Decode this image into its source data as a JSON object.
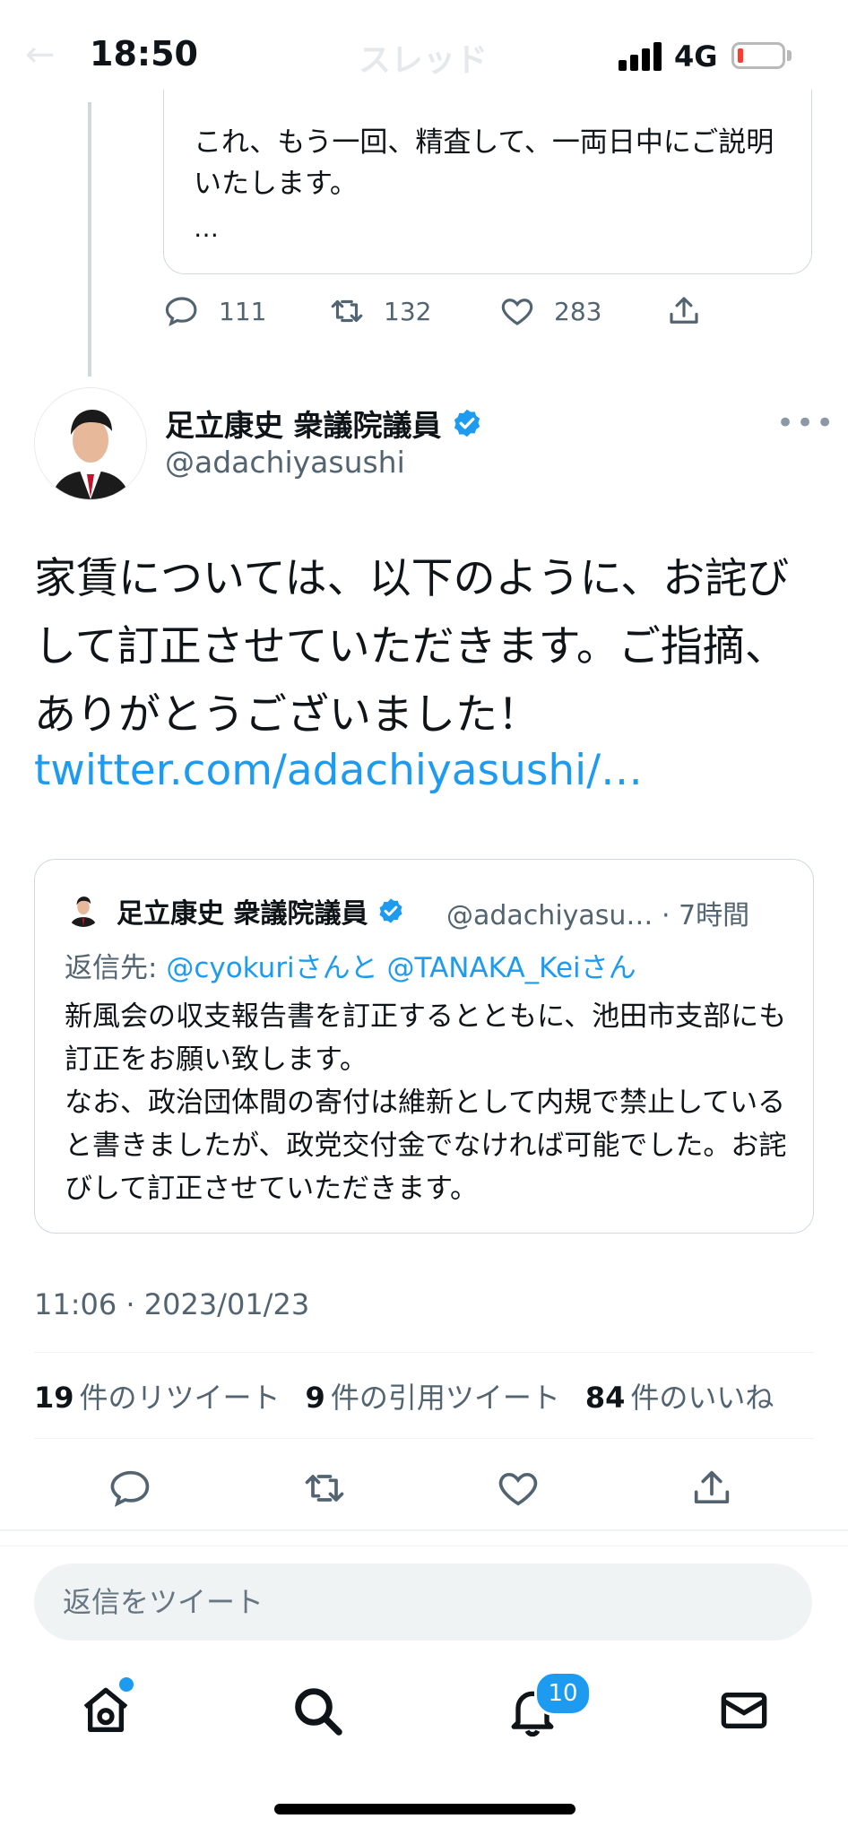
{
  "status_bar": {
    "time": "18:50",
    "network": "4G",
    "ghost_title": "スレッド"
  },
  "previous_tweet": {
    "text": "これ、もう一回、精査して、一両日中にご説明いたします。",
    "ellipsis": "…",
    "replies": "111",
    "retweets": "132",
    "likes": "283"
  },
  "tweet": {
    "display_name": "足立康史 衆議院議員",
    "handle": "@adachiyasushi",
    "body": "家賃については、以下のように、お詫びして訂正させていただきます。ご指摘、ありがとうございました！",
    "link": "twitter.com/adachiyasushi/…",
    "timestamp": "11:06 · 2023/01/23",
    "retweets_count": "19",
    "retweets_label": "件のリツイート",
    "quotes_count": "9",
    "quotes_label": "件の引用ツイート",
    "likes_count": "84",
    "likes_label": "件のいいね"
  },
  "quoted_tweet": {
    "display_name": "足立康史 衆議院議員",
    "handle": "@adachiyasu…",
    "time": "· 7時間",
    "reply_prefix": "返信先: ",
    "reply_user1": "@cyokuri",
    "reply_mid": "さんと ",
    "reply_user2": "@TANAKA_Kei",
    "reply_suffix": "さん",
    "text": "新風会の収支報告書を訂正するとともに、池田市支部にも訂正をお願い致します。\nなお、政治団体間の寄付は維新として内規で禁止していると書きましたが、政党交付金でなければ可能でした。お詫びして訂正させていただきます。"
  },
  "reply_bar": {
    "placeholder": "返信をツイート"
  },
  "tab_bar": {
    "notifications_badge": "10"
  },
  "colors": {
    "accent": "#1d9bf0",
    "text": "#0f1419",
    "secondary": "#536471"
  },
  "icons": [
    "reply-icon",
    "retweet-icon",
    "like-icon",
    "share-icon",
    "verified-badge-icon",
    "more-icon",
    "home-icon",
    "search-icon",
    "notifications-icon",
    "messages-icon"
  ]
}
